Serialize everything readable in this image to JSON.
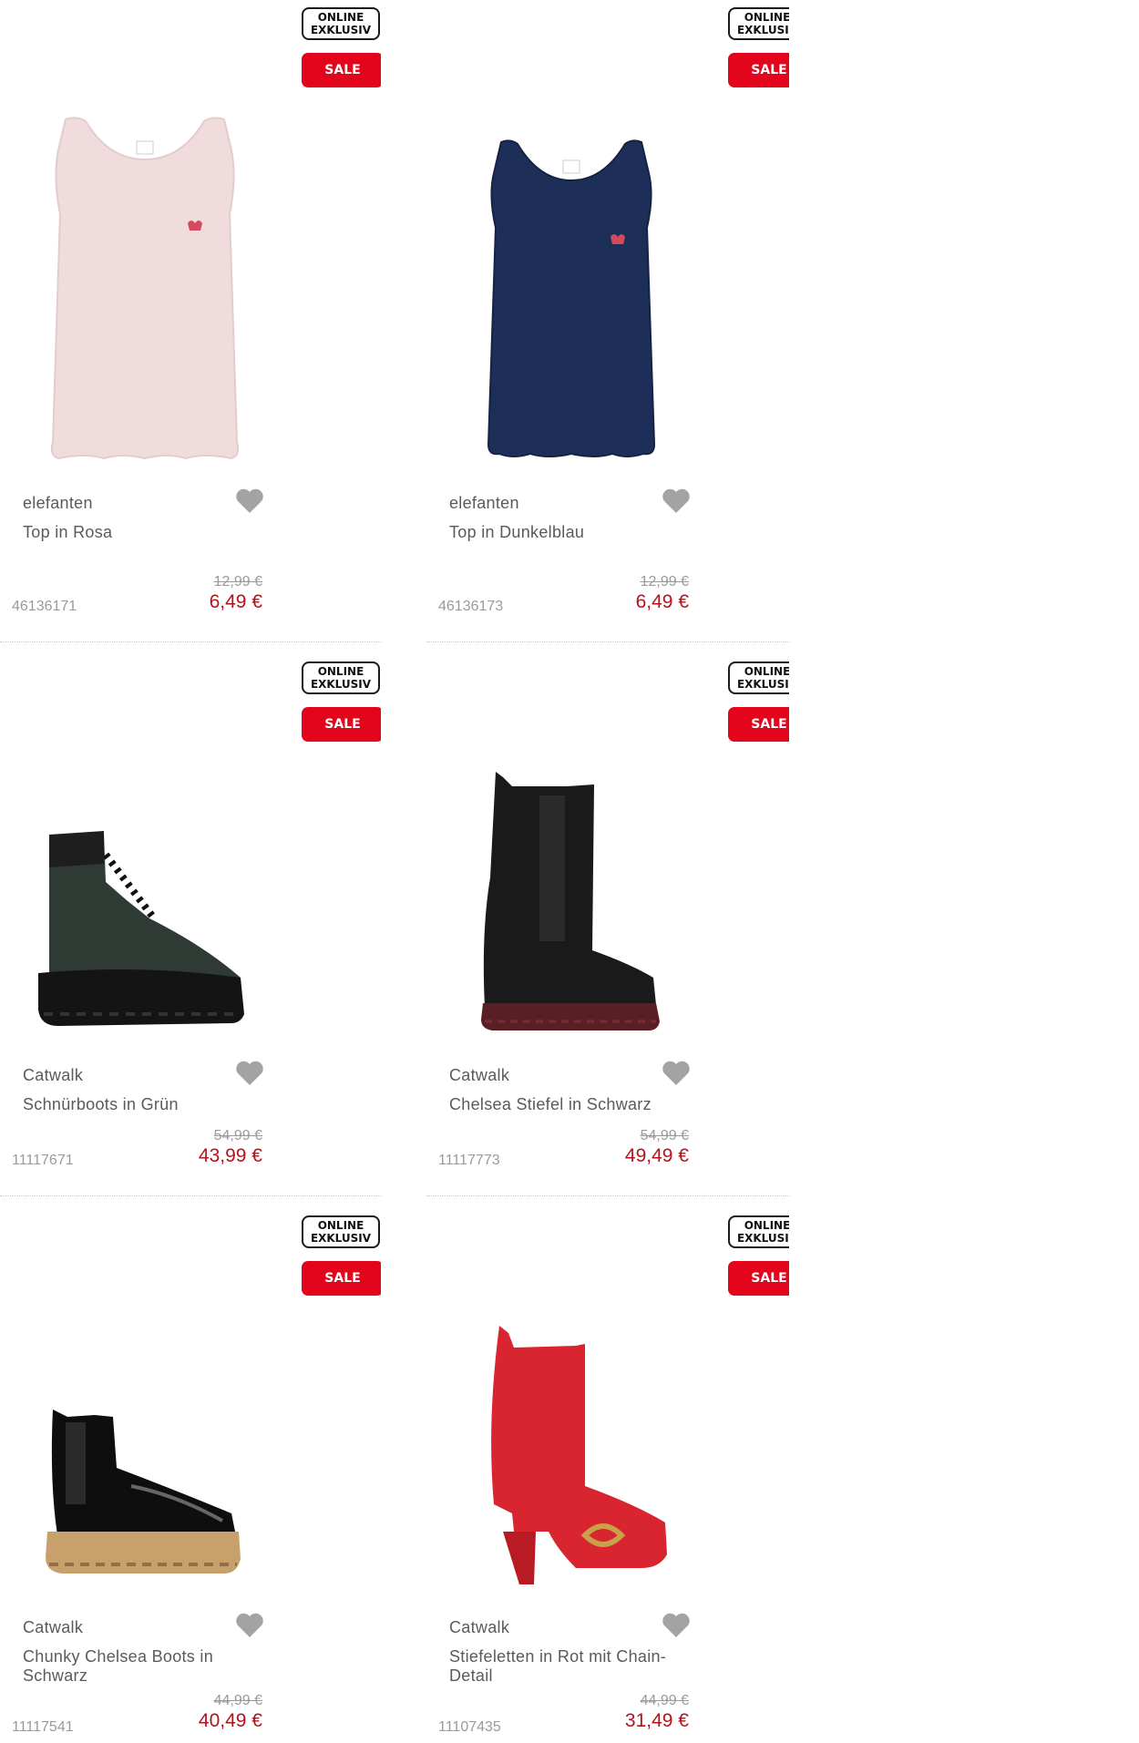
{
  "colors": {
    "sale_red": "#e3051b",
    "price_red": "#b5121b",
    "text_grey": "#5a5a5a",
    "muted_grey": "#9a9a9a"
  },
  "products": [
    {
      "online_line1": "ONLINE",
      "online_line2": "EXKLUSIV",
      "sale": "SALE",
      "brand": "elefanten",
      "name": "Top in Rosa",
      "sku": "46136171",
      "old_price": "12,99 €",
      "new_price": "6,49 €",
      "icon": "heart-icon",
      "image": "pink-tank-top"
    },
    {
      "online_line1": "ONLINE",
      "online_line2": "EXKLUSIV",
      "sale": "SALE",
      "brand": "elefanten",
      "name": "Top in Dunkelblau",
      "sku": "46136173",
      "old_price": "12,99 €",
      "new_price": "6,49 €",
      "icon": "heart-icon",
      "image": "navy-tank-top"
    },
    {
      "online_line1": "ONLINE",
      "online_line2": "EXKLUSIV",
      "sale": "SALE",
      "brand": "Catwalk",
      "name": "Schnürboots in Grün",
      "sku": "11117671",
      "old_price": "54,99 €",
      "new_price": "43,99 €",
      "icon": "heart-icon",
      "image": "green-lace-up-boot"
    },
    {
      "online_line1": "ONLINE",
      "online_line2": "EXKLUSIV",
      "sale": "SALE",
      "brand": "Catwalk",
      "name": "Chelsea Stiefel in Schwarz",
      "sku": "11117773",
      "old_price": "54,99 €",
      "new_price": "49,49 €",
      "icon": "heart-icon",
      "image": "black-chelsea-tall-boot"
    },
    {
      "online_line1": "ONLINE",
      "online_line2": "EXKLUSIV",
      "sale": "SALE",
      "brand": "Catwalk",
      "name": "Chunky Chelsea Boots in Schwarz",
      "sku": "11117541",
      "old_price": "44,99 €",
      "new_price": "40,49 €",
      "icon": "heart-icon",
      "image": "black-patent-chelsea-boot"
    },
    {
      "online_line1": "ONLINE",
      "online_line2": "EXKLUSIV",
      "sale": "SALE",
      "brand": "Catwalk",
      "name": "Stiefeletten in Rot mit Chain-Detail",
      "sku": "11107435",
      "old_price": "44,99 €",
      "new_price": "31,49 €",
      "icon": "heart-icon",
      "image": "red-heeled-ankle-boot"
    }
  ]
}
